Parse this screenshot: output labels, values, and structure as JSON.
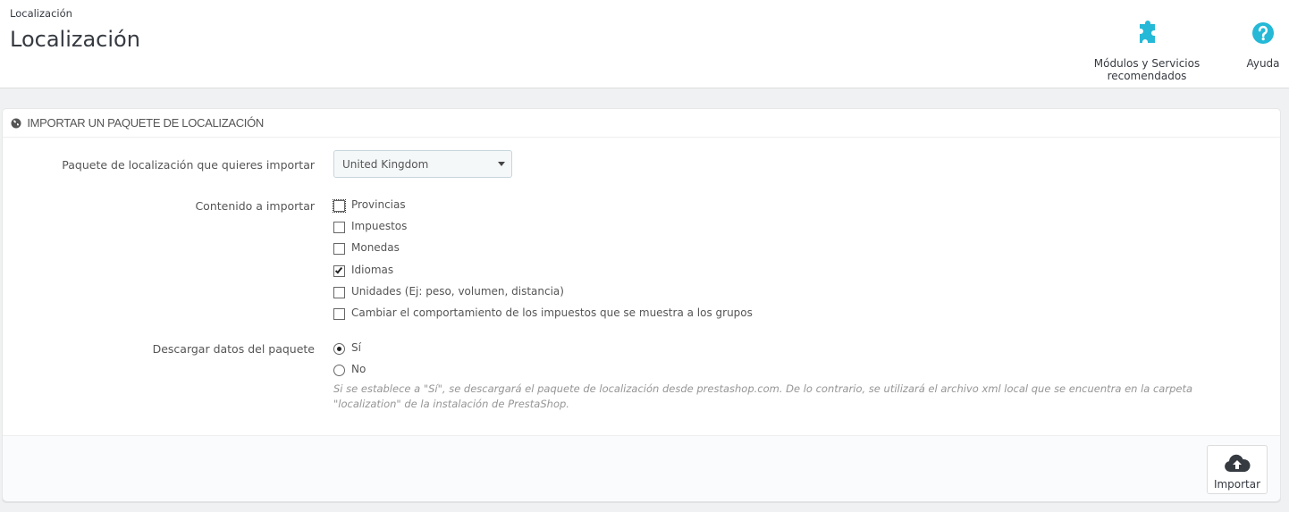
{
  "header": {
    "breadcrumb": "Localización",
    "title": "Localización",
    "toolbar": {
      "modules_label": "Módulos y Servicios recomendados",
      "help_label": "Ayuda",
      "icon_color": "#25b9d7"
    }
  },
  "panel": {
    "heading": "Importar un paquete de localización",
    "package_field": {
      "label": "Paquete de localización que quieres importar",
      "selected": "United Kingdom"
    },
    "content_field": {
      "label": "Contenido a importar",
      "options": [
        {
          "label": "Provincias",
          "checked": false
        },
        {
          "label": "Impuestos",
          "checked": false
        },
        {
          "label": "Monedas",
          "checked": false
        },
        {
          "label": "Idiomas",
          "checked": true
        },
        {
          "label": "Unidades (Ej: peso, volumen, distancia)",
          "checked": false
        },
        {
          "label": "Cambiar el comportamiento de los impuestos que se muestra a los grupos",
          "checked": false
        }
      ]
    },
    "download_field": {
      "label": "Descargar datos del paquete",
      "options": [
        {
          "label": "Sí",
          "selected": true
        },
        {
          "label": "No",
          "selected": false
        }
      ],
      "help": "Si se establece a \"Sí\", se descargará el paquete de localización desde prestashop.com. De lo contrario, se utilizará el archivo xml local que se encuentra en la carpeta \"localization\" de la instalación de PrestaShop."
    },
    "footer": {
      "import_label": "Importar"
    }
  }
}
